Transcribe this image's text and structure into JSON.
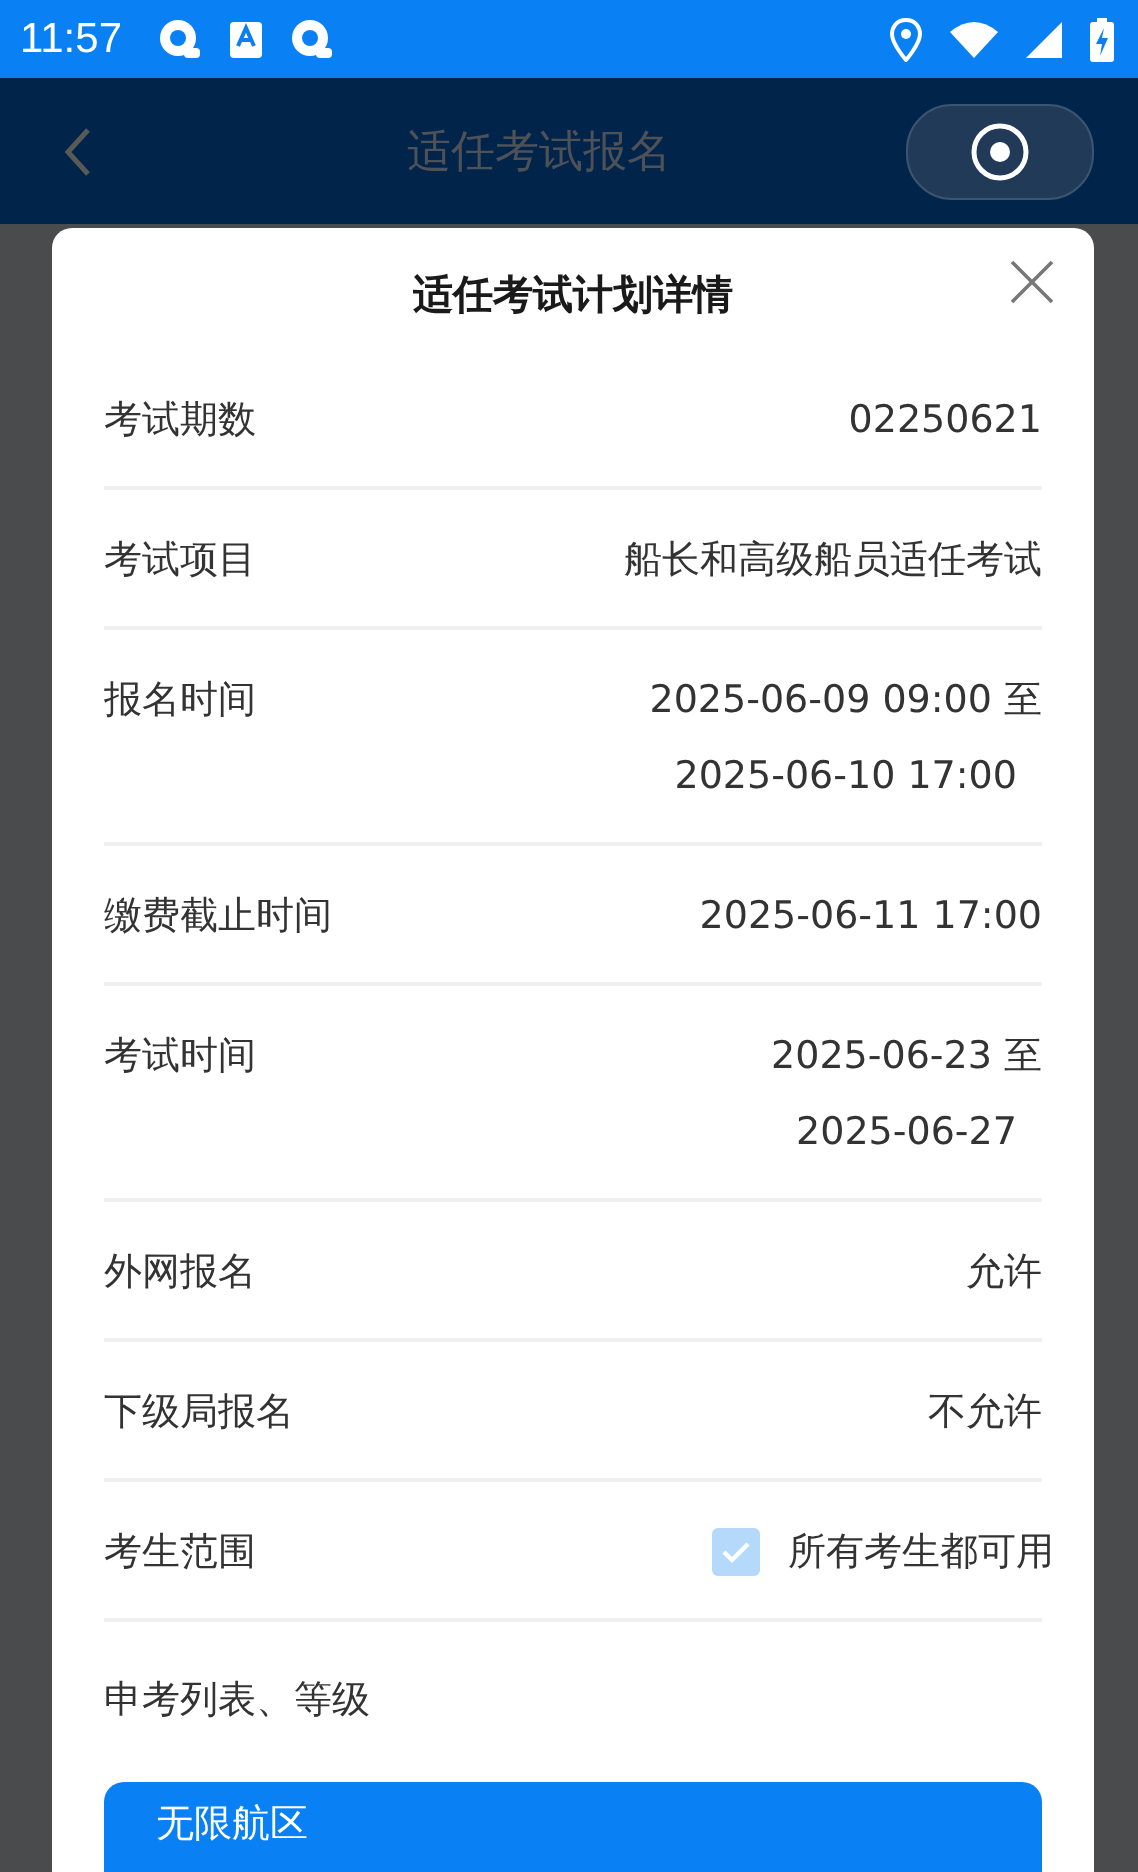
{
  "status_bar": {
    "time": "11:57"
  },
  "header": {
    "title": "适任考试报名"
  },
  "dialog": {
    "title": "适任考试计划详情",
    "rows": [
      {
        "kind": "text",
        "label": "考试期数",
        "lines": [
          "02250621"
        ]
      },
      {
        "kind": "text",
        "label": "考试项目",
        "lines": [
          "船长和高级船员适任考试"
        ]
      },
      {
        "kind": "text",
        "label": "报名时间",
        "lines": [
          "2025-06-09 09:00 至",
          "2025-06-10 17:00"
        ]
      },
      {
        "kind": "text",
        "label": "缴费截止时间",
        "lines": [
          "2025-06-11 17:00"
        ]
      },
      {
        "kind": "text",
        "label": "考试时间",
        "lines": [
          "2025-06-23 至",
          "2025-06-27"
        ]
      },
      {
        "kind": "text",
        "label": "外网报名",
        "lines": [
          "允许"
        ]
      },
      {
        "kind": "text",
        "label": "下级局报名",
        "lines": [
          "不允许"
        ]
      },
      {
        "kind": "checkbox",
        "label": "考生范围",
        "option": "所有考生都可用",
        "checked": true,
        "disabled": true
      }
    ],
    "section_title": "申考列表、等级",
    "list": [
      {
        "label": "无限航区"
      }
    ]
  }
}
